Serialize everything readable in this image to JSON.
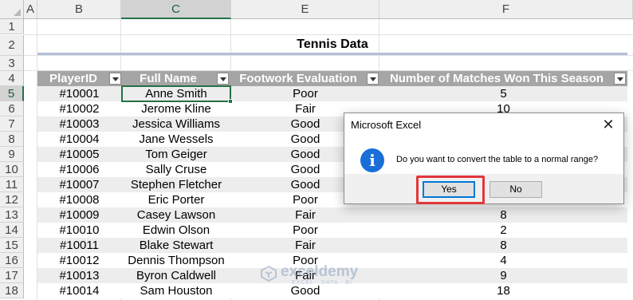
{
  "columns": [
    "A",
    "B",
    "C",
    "E",
    "F"
  ],
  "rows": [
    "1",
    "2",
    "3",
    "4",
    "5",
    "6",
    "7",
    "8",
    "9",
    "10",
    "11",
    "12",
    "13",
    "14",
    "15",
    "16",
    "17",
    "18"
  ],
  "title": "Tennis Data",
  "table": {
    "headers": [
      "PlayerID",
      "Full Name",
      "Footwork Evaluation",
      "Number of Matches Won This Season"
    ],
    "rows": [
      {
        "id": "#10001",
        "name": "Anne Smith",
        "eval": "Poor",
        "wins": "5"
      },
      {
        "id": "#10002",
        "name": "Jerome Kline",
        "eval": "Fair",
        "wins": "10"
      },
      {
        "id": "#10003",
        "name": "Jessica Williams",
        "eval": "Good",
        "wins": ""
      },
      {
        "id": "#10004",
        "name": "Jane Wessels",
        "eval": "Good",
        "wins": ""
      },
      {
        "id": "#10005",
        "name": "Tom Geiger",
        "eval": "Good",
        "wins": ""
      },
      {
        "id": "#10006",
        "name": "Sally Cruse",
        "eval": "Good",
        "wins": ""
      },
      {
        "id": "#10007",
        "name": "Stephen Fletcher",
        "eval": "Good",
        "wins": ""
      },
      {
        "id": "#10008",
        "name": "Eric Porter",
        "eval": "Poor",
        "wins": ""
      },
      {
        "id": "#10009",
        "name": "Casey Lawson",
        "eval": "Fair",
        "wins": "8"
      },
      {
        "id": "#10010",
        "name": "Edwin Olson",
        "eval": "Poor",
        "wins": "2"
      },
      {
        "id": "#10011",
        "name": "Blake Stewart",
        "eval": "Fair",
        "wins": "8"
      },
      {
        "id": "#10012",
        "name": "Dennis Thompson",
        "eval": "Poor",
        "wins": "4"
      },
      {
        "id": "#10013",
        "name": "Byron Caldwell",
        "eval": "Fair",
        "wins": "9"
      },
      {
        "id": "#10014",
        "name": "Sam Houston",
        "eval": "Good",
        "wins": "18"
      }
    ]
  },
  "dialog": {
    "title": "Microsoft Excel",
    "close_glyph": "✕",
    "icon_glyph": "i",
    "message": "Do you want to convert the table to a normal range?",
    "yes_label": "Yes",
    "no_label": "No"
  },
  "watermark": {
    "name": "exceldemy",
    "tagline": "EXCEL · DATA · BI"
  },
  "colors": {
    "accent": "#217346",
    "table_header": "#a5a5a5",
    "band": "#ededed",
    "highlight": "#e2373b",
    "info_icon": "#1a6ed8"
  }
}
